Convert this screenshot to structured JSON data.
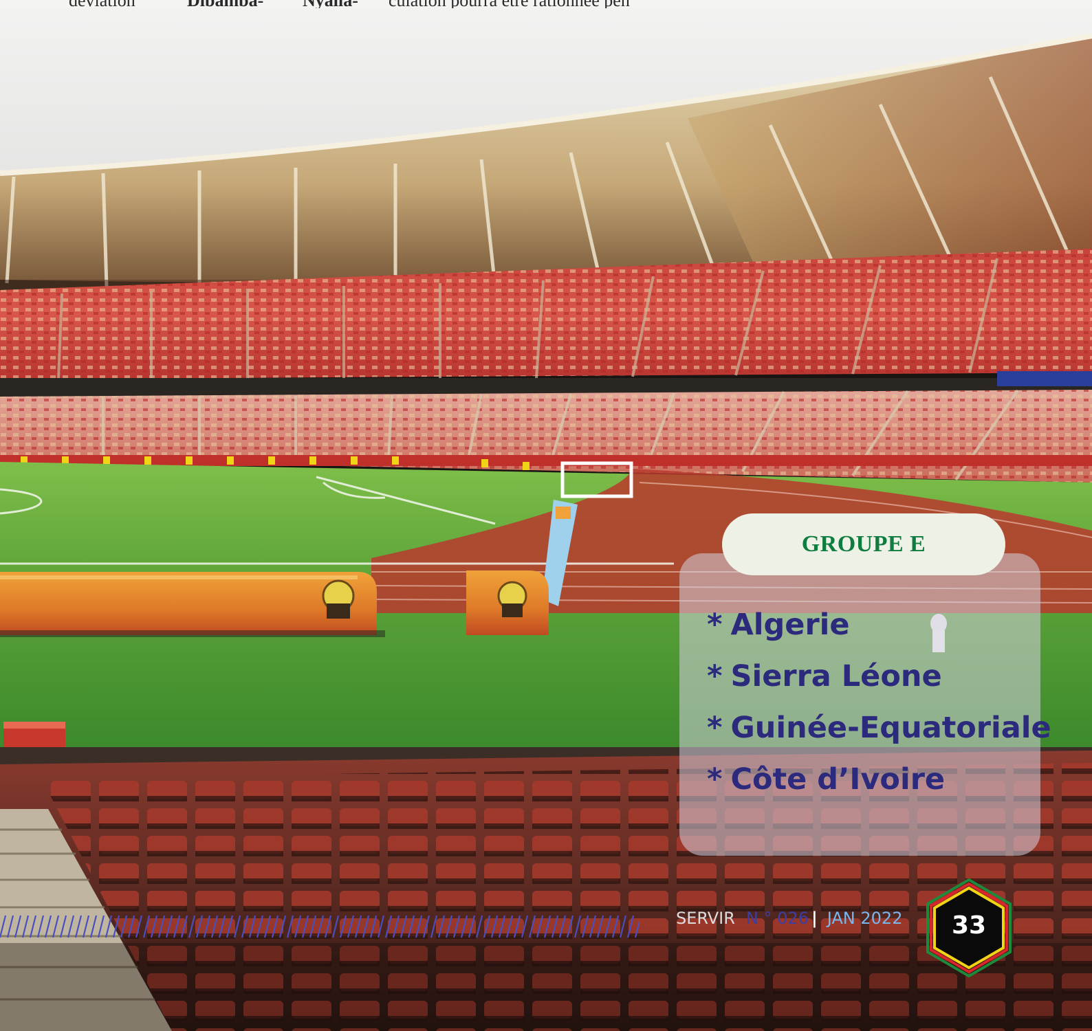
{
  "top_text": {
    "fragment_1": "déviation",
    "fragment_2": "Dibamba-",
    "fragment_3": "Nyalla-",
    "fragment_4": "culation pourra être rationnée pen"
  },
  "group": {
    "title": "GROUPE E",
    "bullet": "*",
    "teams": [
      "Algerie",
      "Sierra Léone",
      "Guinée-Equatoriale",
      "Côte d’Ivoire"
    ],
    "colors": {
      "title": "#0f7d3f",
      "teams": "#2c2a7c"
    }
  },
  "footer": {
    "publication": "SERVIR",
    "issue": "N ° 026",
    "separator": "|",
    "date": "JAN 2022",
    "page_number": "33",
    "colors": {
      "issue": "#3a3fa8",
      "date": "#78b6ee",
      "badge": [
        "#1e8a3c",
        "#d8262a",
        "#f2d416"
      ]
    }
  }
}
